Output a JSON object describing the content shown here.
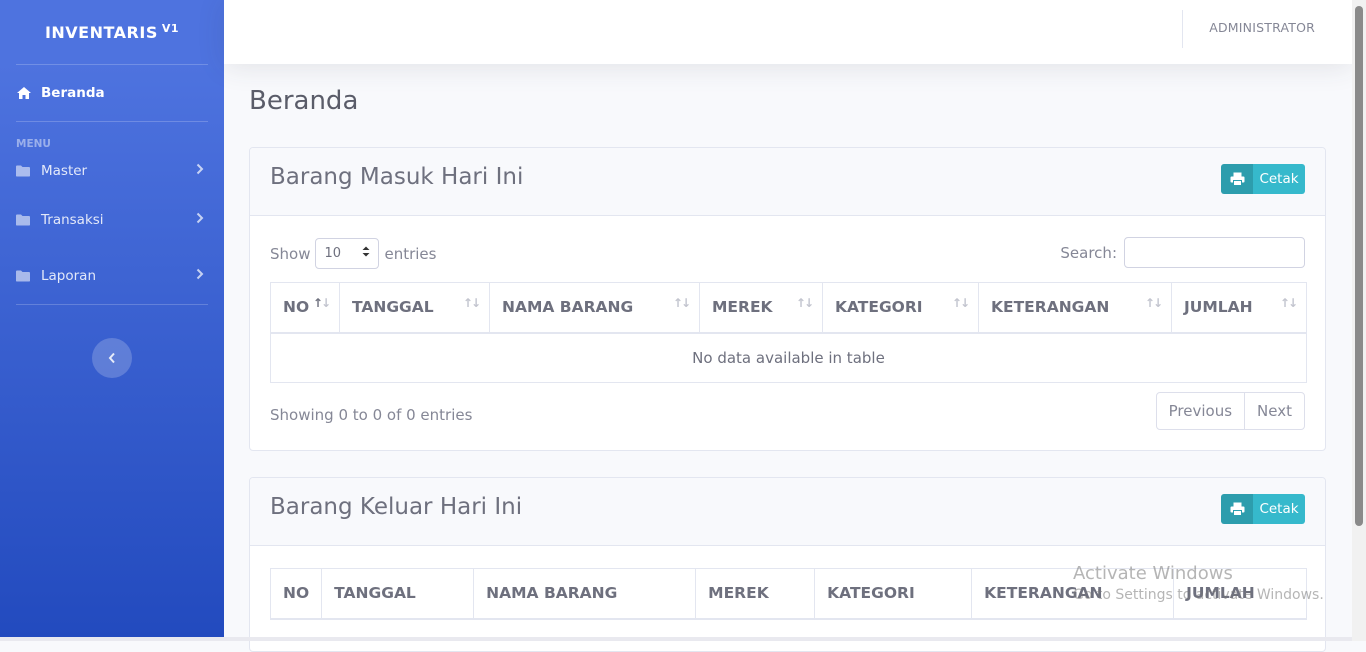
{
  "sidebar": {
    "brand": "INVENTARIS",
    "brand_version": "V1",
    "home_label": "Beranda",
    "heading": "MENU",
    "items": [
      {
        "label": "Master"
      },
      {
        "label": "Transaksi"
      },
      {
        "label": "Laporan"
      }
    ]
  },
  "topbar": {
    "user": "ADMINISTRATOR"
  },
  "page": {
    "title": "Beranda"
  },
  "masuk": {
    "title": "Barang Masuk Hari Ini",
    "print_label": "Cetak",
    "show_label": "Show",
    "entries_label": "entries",
    "page_size": "10",
    "search_label": "Search:",
    "columns": [
      "NO",
      "TANGGAL",
      "NAMA BARANG",
      "MEREK",
      "KATEGORI",
      "KETERANGAN",
      "JUMLAH"
    ],
    "empty_text": "No data available in table",
    "info": "Showing 0 to 0 of 0 entries",
    "previous": "Previous",
    "next": "Next"
  },
  "keluar": {
    "title": "Barang Keluar Hari Ini",
    "print_label": "Cetak",
    "columns": [
      "NO",
      "TANGGAL",
      "NAMA BARANG",
      "MEREK",
      "KATEGORI",
      "KETERANGAN",
      "JUMLAH"
    ]
  },
  "watermark": {
    "line1": "Activate Windows",
    "line2": "Go to Settings to activate Windows."
  },
  "colors": {
    "sidebar_top": "#4e73df",
    "sidebar_bottom": "#224abe",
    "accent_info": "#36b9cc"
  }
}
